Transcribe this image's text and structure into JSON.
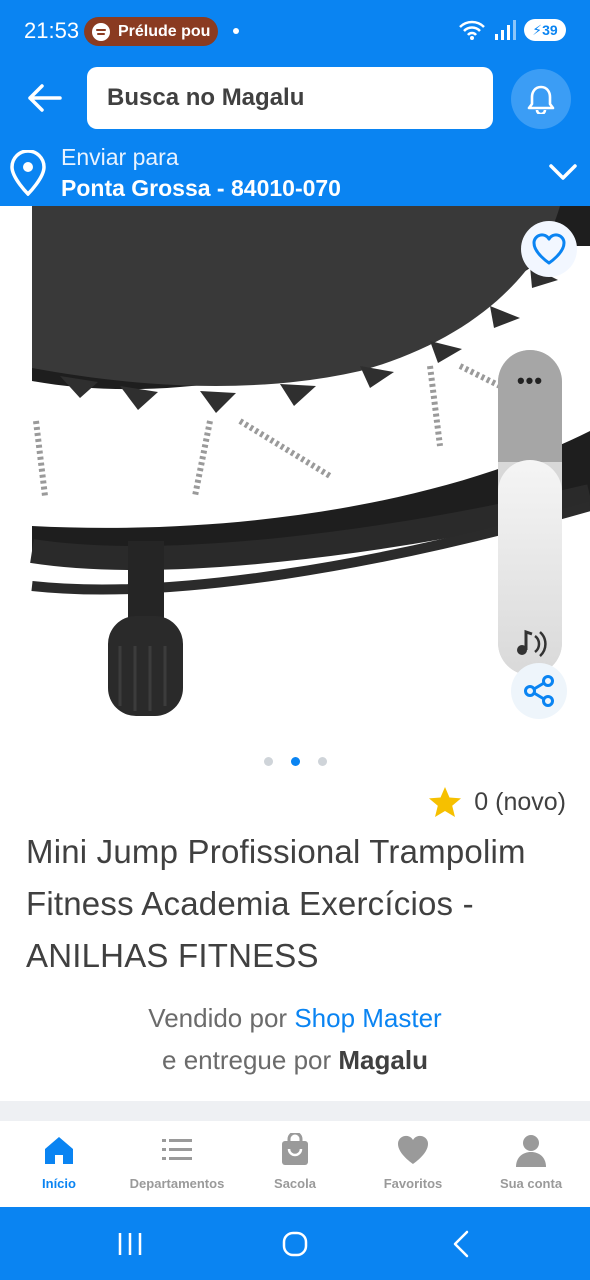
{
  "status_bar": {
    "time": "21:53",
    "media_title": "Prélude pou",
    "battery": "39",
    "colors": {
      "background": "#0a84f2",
      "media_pill": "#8a3b21"
    }
  },
  "header": {
    "search_placeholder": "Busca no Magalu",
    "ship_to_label": "Enviar para",
    "ship_to_location": "Ponta Grossa - 84010-070",
    "brand_color": "#0a84f2"
  },
  "gallery": {
    "page_count": 3,
    "active_page": 2,
    "image_subject": "mini-trampoline"
  },
  "product": {
    "rating": "0 (novo)",
    "rating_icon": "star-icon",
    "title": "Mini Jump Profissional Trampolim Fitness Academia Exercícios - ANILHAS FITNESS",
    "sold_by_prefix": "Vendido por",
    "seller_name": "Shop Master",
    "delivered_by_prefix": "e entregue por",
    "delivered_by": "Magalu"
  },
  "bottom_nav": {
    "items": [
      {
        "label": "Início",
        "icon": "home-icon",
        "active": true
      },
      {
        "label": "Departamentos",
        "icon": "list-icon",
        "active": false
      },
      {
        "label": "Sacola",
        "icon": "bag-icon",
        "active": false
      },
      {
        "label": "Favoritos",
        "icon": "heart-icon",
        "active": false
      },
      {
        "label": "Sua conta",
        "icon": "user-icon",
        "active": false
      }
    ]
  }
}
